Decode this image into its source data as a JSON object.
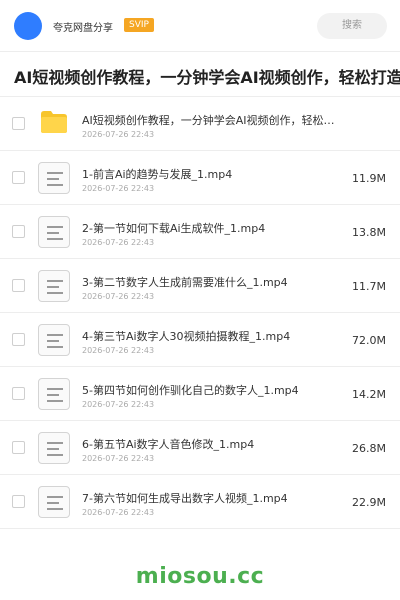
{
  "header": {
    "brand": "夸克网盘分享",
    "vip_badge": "SVIP",
    "search_label": "搜索"
  },
  "page_title": "AI短视频创作教程，一分钟学会AI视频创作，轻松打造爆款",
  "files": [
    {
      "type": "folder",
      "name": "AI短视频创作教程，一分钟学会AI视频创作，轻松打造爆款",
      "date": "2026-07-26 22:43",
      "size": ""
    },
    {
      "type": "file",
      "name": "1-前言Ai的趋势与发展_1.mp4",
      "date": "2026-07-26 22:43",
      "size": "11.9M"
    },
    {
      "type": "file",
      "name": "2-第一节如何下载Ai生成软件_1.mp4",
      "date": "2026-07-26 22:43",
      "size": "13.8M"
    },
    {
      "type": "file",
      "name": "3-第二节数字人生成前需要准什么_1.mp4",
      "date": "2026-07-26 22:43",
      "size": "11.7M"
    },
    {
      "type": "file",
      "name": "4-第三节Ai数字人30视频拍摄教程_1.mp4",
      "date": "2026-07-26 22:43",
      "size": "72.0M"
    },
    {
      "type": "file",
      "name": "5-第四节如何创作驯化自己的数字人_1.mp4",
      "date": "2026-07-26 22:43",
      "size": "14.2M"
    },
    {
      "type": "file",
      "name": "6-第五节Ai数字人音色修改_1.mp4",
      "date": "2026-07-26 22:43",
      "size": "26.8M"
    },
    {
      "type": "file",
      "name": "7-第六节如何生成导出数字人视频_1.mp4",
      "date": "2026-07-26 22:43",
      "size": "22.9M"
    }
  ],
  "footer_brand": "miosou.cc",
  "colors": {
    "accent": "#2f7dff",
    "vip": "#f5a623",
    "watermark": "#4caf50",
    "folder": "#f7c52c"
  }
}
